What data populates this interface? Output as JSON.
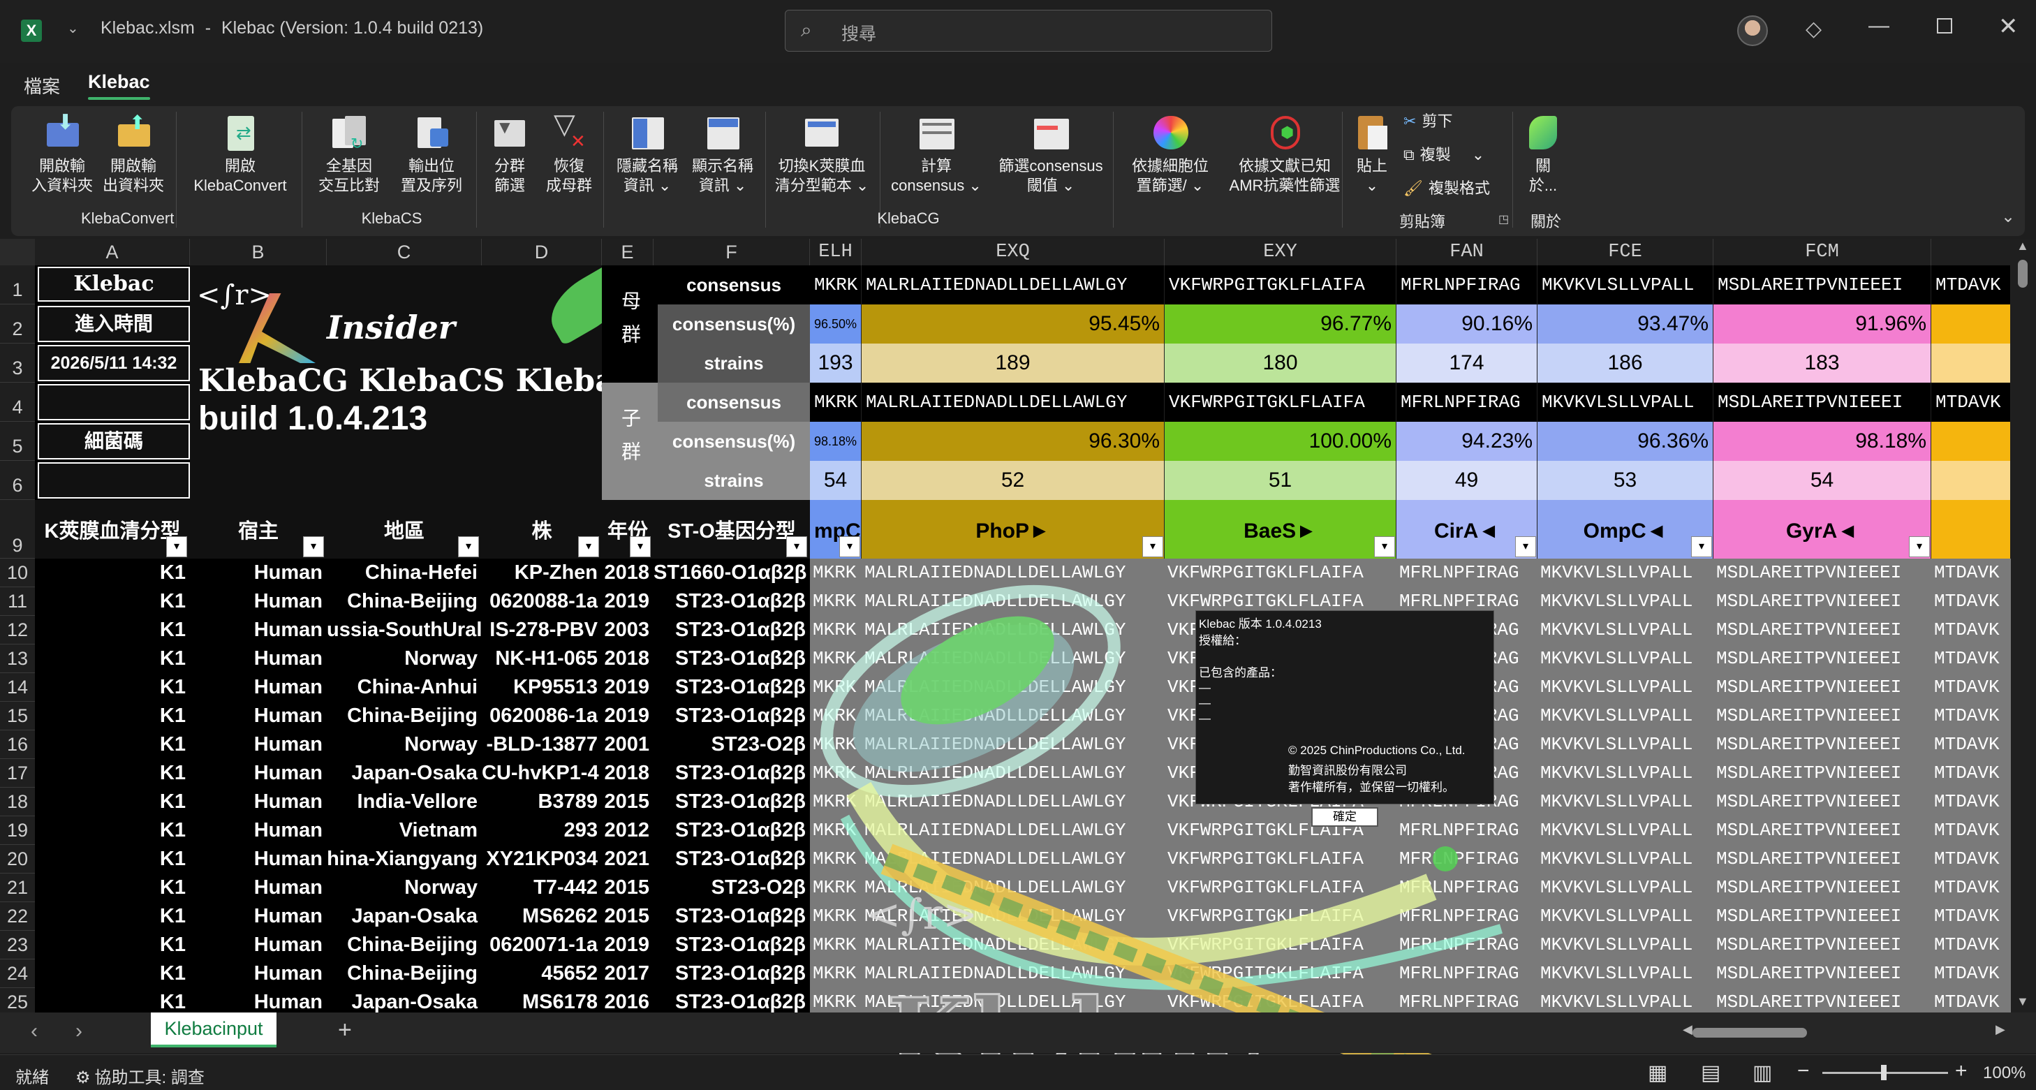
{
  "title": {
    "file": "Klebac.xlsm",
    "separator": "-",
    "app": "Klebac (Version: 1.0.4 build 0213)",
    "search_placeholder": "搜尋",
    "icon": "excel-icon"
  },
  "menu": {
    "file": "檔案",
    "klebac": "Klebac"
  },
  "ribbon": {
    "groups": [
      "KlebaConvert",
      "KlebaCS",
      "KlebaCG",
      "剪貼簿",
      "關於"
    ],
    "buttons": [
      {
        "l1": "開啟輸",
        "l2": "入資料夾",
        "icon": "folder-in-icon"
      },
      {
        "l1": "開啟輸",
        "l2": "出資料夾",
        "icon": "folder-out-icon"
      },
      {
        "l1": "開啟",
        "l2": "KlebaConvert",
        "icon": "convert-icon"
      },
      {
        "l1": "全基因",
        "l2": "交互比對",
        "icon": "compare-icon"
      },
      {
        "l1": "輸出位",
        "l2": "置及序列",
        "icon": "export-icon"
      },
      {
        "l1": "分群",
        "l2": "篩選",
        "icon": "cluster-filter-icon"
      },
      {
        "l1": "恢復",
        "l2": "成母群",
        "icon": "clear-filter-icon"
      },
      {
        "l1": "隱藏名稱",
        "l2": "資訊 ⌄",
        "icon": "hide-names-icon"
      },
      {
        "l1": "顯示名稱",
        "l2": "資訊 ⌄",
        "icon": "show-names-icon"
      },
      {
        "l1": "切換K莢膜血",
        "l2": "清分型範本 ⌄",
        "icon": "template-icon"
      },
      {
        "l1": "計算",
        "l2": "consensus ⌄",
        "icon": "calculate-icon"
      },
      {
        "l1": "篩選consensus",
        "l2": "閾值 ⌄",
        "icon": "threshold-icon"
      },
      {
        "l1": "依據細胞位",
        "l2": "置篩選/ ⌄",
        "icon": "palette-icon"
      },
      {
        "l1": "依據文獻已知",
        "l2": "AMR抗藥性篩選",
        "icon": "amr-icon"
      }
    ],
    "clipboard": {
      "paste": "貼上",
      "paste2": "⌄",
      "cut": "剪下",
      "copy": "複製",
      "format": "複製格式"
    },
    "about": {
      "l1": "關",
      "l2": "於..."
    }
  },
  "columns": [
    "A",
    "B",
    "C",
    "D",
    "E",
    "F",
    "ELH",
    "EXQ",
    "EXY",
    "FAN",
    "FCE",
    "FCM"
  ],
  "rows": [
    "1",
    "2",
    "3",
    "4",
    "5",
    "6",
    "9",
    "10",
    "11",
    "12",
    "13",
    "14",
    "15",
    "16",
    "17",
    "18",
    "19",
    "20",
    "21",
    "22",
    "23",
    "24",
    "25"
  ],
  "header": {
    "app_name": "Klebac",
    "entry_time": "進入時間",
    "datetime": "2026/5/11 14:32",
    "bact_code": "細菌碼",
    "logo_text": "Insider",
    "logo_line1": "KlebaCG KlebaCS Klebac",
    "logo_line2": "build 1.0.4.213",
    "mother": "母群",
    "child": "子群",
    "labels": {
      "consensus": "consensus",
      "pct": "consensus(%)",
      "strains": "strains"
    }
  },
  "genes": [
    {
      "seq": "MKRK",
      "m_pct": "96.50%",
      "m_str": "193",
      "c_pct": "98.18%",
      "c_str": "54",
      "name": "mpC",
      "color": "#6d95f0",
      "light": "#b9ccf7"
    },
    {
      "seq": "MALRLAIIEDNADLLDELLAWLGY",
      "m_pct": "95.45%",
      "m_str": "189",
      "c_pct": "96.30%",
      "c_str": "52",
      "name": "PhoP►",
      "color": "#b8960b",
      "light": "#e6d59a"
    },
    {
      "seq": "VKFWRPGITGKLFLAIFA",
      "m_pct": "96.77%",
      "m_str": "180",
      "c_pct": "100.00%",
      "c_str": "51",
      "name": "BaeS►",
      "color": "#6fc71f",
      "light": "#bce49a"
    },
    {
      "seq": "MFRLNPFIRAG",
      "m_pct": "90.16%",
      "m_str": "174",
      "c_pct": "94.23%",
      "c_str": "49",
      "name": "CirA◄",
      "color": "#a8b6f7",
      "light": "#d7def9"
    },
    {
      "seq": "MKVKVLSLLVPALL",
      "m_pct": "93.47%",
      "m_str": "186",
      "c_pct": "96.36%",
      "c_str": "53",
      "name": "OmpC◄",
      "color": "#8fa6f2",
      "light": "#c6d3f8"
    },
    {
      "seq": "MSDLAREITPVNIEEEI",
      "m_pct": "91.96%",
      "m_str": "183",
      "c_pct": "98.18%",
      "c_str": "54",
      "name": "GyrA◄",
      "color": "#f37ed0",
      "light": "#f9bfe6"
    },
    {
      "seq": "MTDAVK",
      "m_pct": "",
      "m_str": "",
      "c_pct": "",
      "c_str": "",
      "name": "",
      "color": "#f5b50e",
      "light": "#fad889"
    }
  ],
  "table_headers": [
    "K莢膜血清分型",
    "宿主",
    "地區",
    "株",
    "年份",
    "ST-O基因分型"
  ],
  "table_rows": [
    [
      "K1",
      "Human",
      "China-Hefei",
      "KP-Zhen",
      "2018",
      "ST1660-O1αβ2β"
    ],
    [
      "K1",
      "Human",
      "China-Beijing",
      "0620088-1a",
      "2019",
      "ST23-O1αβ2β"
    ],
    [
      "K1",
      "Human",
      "ussia-SouthUral",
      "IS-278-PBV",
      "2003",
      "ST23-O1αβ2β"
    ],
    [
      "K1",
      "Human",
      "Norway",
      "NK-H1-065",
      "2018",
      "ST23-O1αβ2β"
    ],
    [
      "K1",
      "Human",
      "China-Anhui",
      "KP95513",
      "2019",
      "ST23-O1αβ2β"
    ],
    [
      "K1",
      "Human",
      "China-Beijing",
      "0620086-1a",
      "2019",
      "ST23-O1αβ2β"
    ],
    [
      "K1",
      "Human",
      "Norway",
      "-BLD-13877",
      "2001",
      "ST23-O2β"
    ],
    [
      "K1",
      "Human",
      "Japan-Osaka",
      "CU-hvKP1-4",
      "2018",
      "ST23-O1αβ2β"
    ],
    [
      "K1",
      "Human",
      "India-Vellore",
      "B3789",
      "2015",
      "ST23-O1αβ2β"
    ],
    [
      "K1",
      "Human",
      "Vietnam",
      "293",
      "2012",
      "ST23-O1αβ2β"
    ],
    [
      "K1",
      "Human",
      "hina-Xiangyang",
      "XY21KP034",
      "2021",
      "ST23-O1αβ2β"
    ],
    [
      "K1",
      "Human",
      "Norway",
      "T7-442",
      "2015",
      "ST23-O2β"
    ],
    [
      "K1",
      "Human",
      "Japan-Osaka",
      "MS6262",
      "2015",
      "ST23-O1αβ2β"
    ],
    [
      "K1",
      "Human",
      "China-Beijing",
      "0620071-1a",
      "2019",
      "ST23-O1αβ2β"
    ],
    [
      "K1",
      "Human",
      "China-Beijing",
      "45652",
      "2017",
      "ST23-O1αβ2β"
    ],
    [
      "K1",
      "Human",
      "Japan-Osaka",
      "MS6178",
      "2016",
      "ST23-O1αβ2β"
    ]
  ],
  "about_dialog": {
    "title": "Klebac 版本 1.0.4.0213",
    "licensed": "授權給：",
    "products": "已包含的產品：",
    "dashes": [
      "—",
      "—",
      "—"
    ],
    "copyright": "© 2025 ChinProductions Co., Ltd.",
    "company": "勤智資訊股份有限公司",
    "rights": "著作權所有，並保留一切權利。",
    "ok": "確定"
  },
  "splash_text": "Klebac",
  "sheet_tab": "Klebacinput",
  "status": {
    "ready": "就緒",
    "accessibility": "協助工具: 調查",
    "zoom": "100%"
  }
}
